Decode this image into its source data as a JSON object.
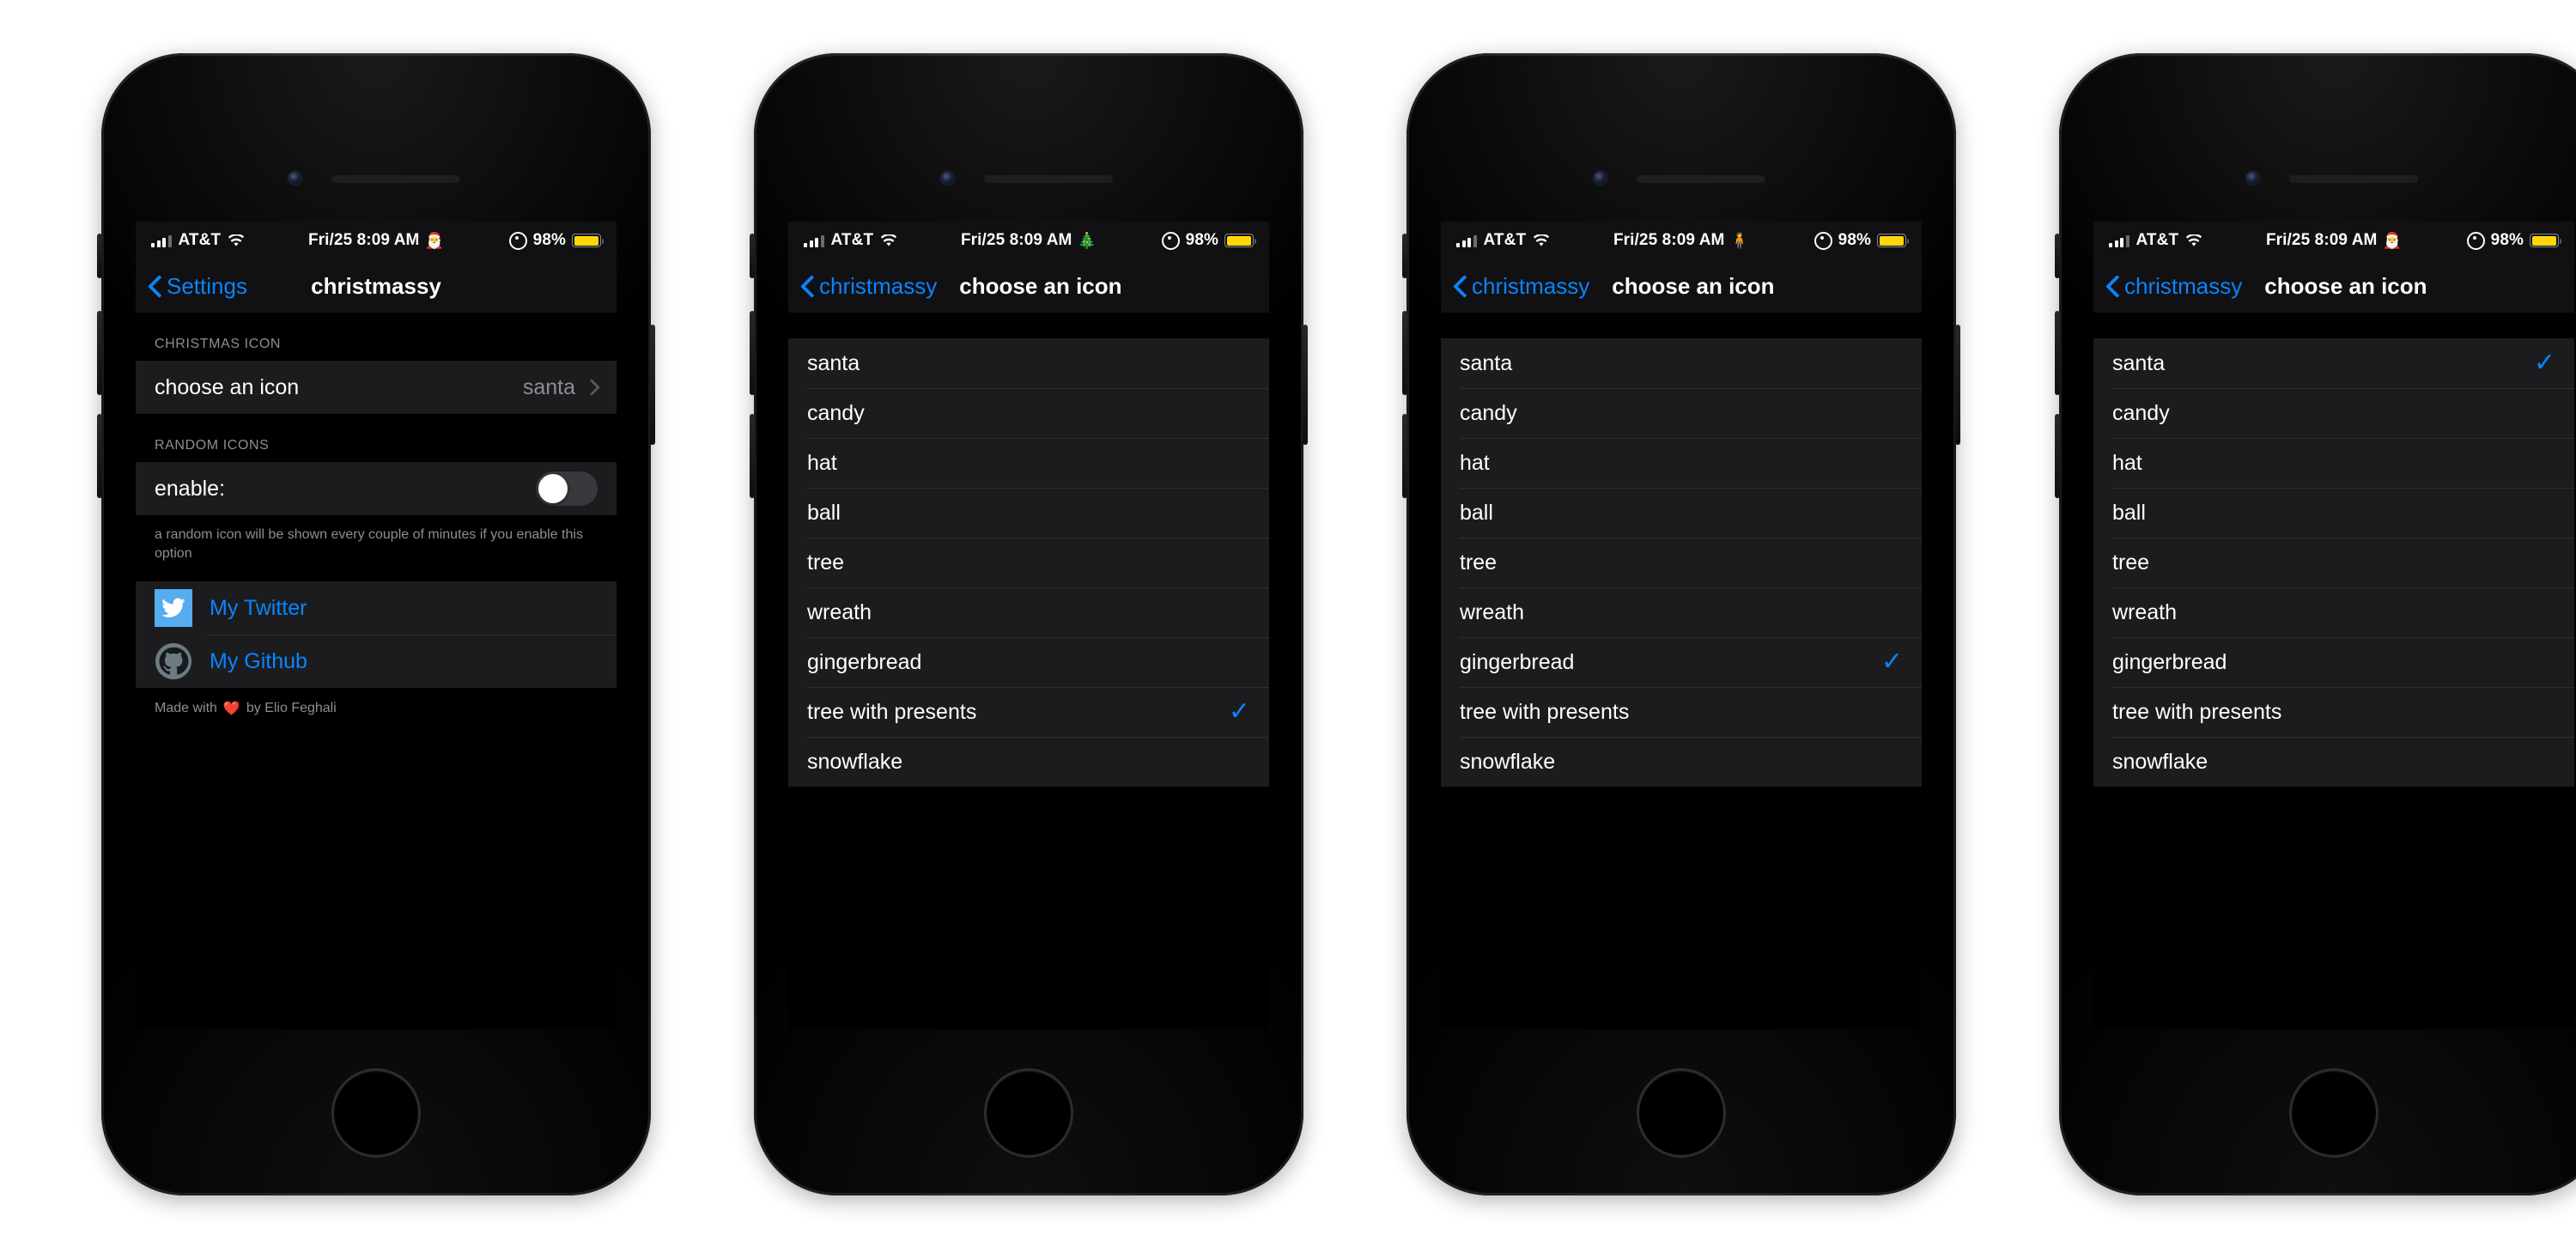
{
  "phones": [
    {
      "id": "phone-settings",
      "status": {
        "carrier": "AT&T",
        "time": "Fri/25 8:09 AM",
        "emoji": "🎅",
        "emoji_name": "santa-emoji",
        "battery_pct": "98%"
      },
      "nav": {
        "back": "Settings",
        "title": "christmassy",
        "title_centered": true
      },
      "sections": {
        "christmas_icon_header": "CHRISTMAS ICON",
        "choose_row_label": "choose an icon",
        "choose_row_value": "santa",
        "random_icons_header": "RANDOM ICONS",
        "enable_label": "enable:",
        "enable_state": "off",
        "footnote": "a random icon will be shown every couple of minutes if you enable this option",
        "twitter_label": "My Twitter",
        "github_label": "My Github",
        "made_by_prefix": "Made with",
        "made_by_heart": "❤️",
        "made_by_suffix": "by Elio Feghali"
      }
    },
    {
      "id": "phone-tree-with-presents",
      "status": {
        "carrier": "AT&T",
        "time": "Fri/25 8:09 AM",
        "emoji": "🎄",
        "emoji_name": "christmas-tree-emoji",
        "battery_pct": "98%"
      },
      "nav": {
        "back": "christmassy",
        "title": "choose an icon",
        "title_centered": false
      },
      "selected": "tree with presents"
    },
    {
      "id": "phone-gingerbread",
      "status": {
        "carrier": "AT&T",
        "time": "Fri/25 8:09 AM",
        "emoji": "🧍",
        "emoji_name": "gingerbread-man-emoji",
        "battery_pct": "98%"
      },
      "nav": {
        "back": "christmassy",
        "title": "choose an icon",
        "title_centered": false
      },
      "selected": "gingerbread"
    },
    {
      "id": "phone-santa",
      "status": {
        "carrier": "AT&T",
        "time": "Fri/25 8:09 AM",
        "emoji": "🎅",
        "emoji_name": "santa-emoji",
        "battery_pct": "98%"
      },
      "nav": {
        "back": "christmassy",
        "title": "choose an icon",
        "title_centered": false
      },
      "selected": "santa"
    }
  ],
  "icon_options": [
    "santa",
    "candy",
    "hat",
    "ball",
    "tree",
    "wreath",
    "gingerbread",
    "tree with presents",
    "snowflake"
  ],
  "colors": {
    "accent_blue": "#0a84ff",
    "row_bg": "#1c1c1e",
    "screen_bg": "#000000",
    "secondary_text": "#8e8e93",
    "battery_yellow": "#ffd60a",
    "twitter_blue": "#55acee",
    "github_gray": "#6e7b80",
    "heart_red": "#ff3b30"
  },
  "glyphs": {
    "checkmark": "✓",
    "disclosure": "›"
  }
}
